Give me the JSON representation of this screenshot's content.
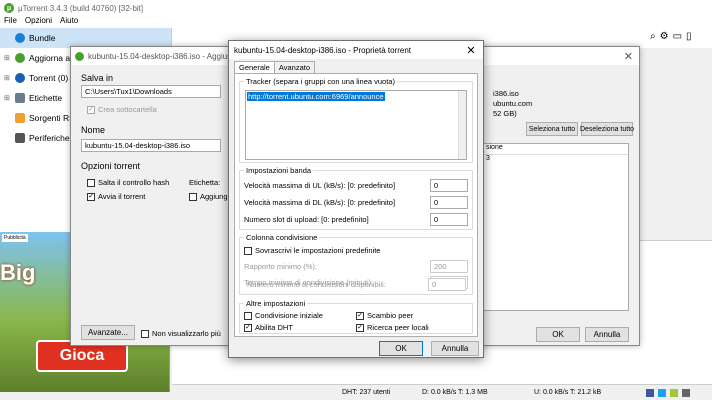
{
  "app": {
    "title": "µTorrent 3.4.3  (build 40760) [32-bit]",
    "menu": [
      "File",
      "Opzioni",
      "Aiuto"
    ]
  },
  "sidebar": {
    "items": [
      {
        "label": "Bundle",
        "color": "#1a7fd4"
      },
      {
        "label": "Aggiorna a Pr",
        "color": "#4aa02c"
      },
      {
        "label": "Torrent (0)",
        "color": "#1a5fb4"
      },
      {
        "label": "Etichette",
        "color": "#6b7b8c"
      },
      {
        "label": "Sorgenti RSS",
        "color": "#f0a030"
      },
      {
        "label": "Periferiche (0)",
        "color": "#555555"
      }
    ]
  },
  "ad": {
    "tag": "Pubblicità",
    "headline": "Big",
    "cta": "Gioca"
  },
  "add_dialog": {
    "title": "kubuntu-15.04-desktop-i386.iso - Aggiungi un t",
    "save_label": "Salva in",
    "save_path": "C:\\Users\\Tux1\\Downloads",
    "subfolder_label": "Crea sottocartella",
    "name_label": "Nome",
    "name_value": "kubuntu-15.04-desktop-i386.iso",
    "options_label": "Opzioni torrent",
    "skip_hash": "Salta il controllo hash",
    "start_torrent": "Avvia il torrent",
    "label_label": "Etichetta:",
    "add_label": "Aggiungi",
    "advanced_button": "Avanzate...",
    "dont_show": "Non visualizzarlo più",
    "ok": "OK",
    "cancel": "Annulla",
    "right_name": "i386.iso",
    "right_site": "ubuntu.com",
    "right_size": "52 GB)",
    "select_all": "Seleziona tutto",
    "deselect_all": "Deseleziona tutto",
    "col_header": "sione",
    "col_value": "3"
  },
  "props_dialog": {
    "title": "kubuntu-15.04-desktop-i386.iso - Proprietà torrent",
    "tabs": [
      "Generale",
      "Avanzato"
    ],
    "tracker_label": "Tracker (separa i gruppi con una linea vuota)",
    "tracker_value": "http://torrent.ubuntu.com:6969/announce",
    "band_label": "Impostazioni banda",
    "ul_label": "Velocità massima di UL (kB/s): [0: predefinito]",
    "ul_value": "0",
    "dl_label": "Velocità massima di DL (kB/s): [0: predefinito]",
    "dl_value": "0",
    "slots_label": "Numero slot di upload: [0: predefinito]",
    "slots_value": "0",
    "seed_label": "Colonna condivisione",
    "override_label": "Sovrascrivi le impostazioni predefinite",
    "ratio_label": "Rapporto minimo (%):",
    "ratio_value": "200",
    "time_label": "Tempo minimo di condivisione (minuti):",
    "time_value": "0",
    "min_seeds_label": "Numero minimo di condivisioni disponibili:",
    "min_seeds_value": "0",
    "other_label": "Altre impostazioni",
    "initial_seeding": "Condivisione iniziale",
    "peer_exchange": "Scambio peer",
    "dht": "Abilita DHT",
    "local_peers": "Ricerca peer locali",
    "ok": "OK",
    "cancel": "Annulla"
  },
  "status": {
    "dht": "DHT: 237 utenti",
    "download": "D: 0.0 kB/s T: 1.3 MB",
    "upload": "U: 0.0 kB/s T: 21.2 kB"
  }
}
